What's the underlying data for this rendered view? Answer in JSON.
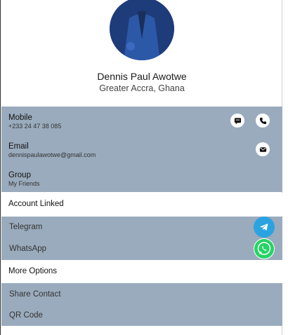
{
  "profile": {
    "name": "Dennis Paul Awotwe",
    "location": "Greater Accra, Ghana",
    "avatar_icon": "profile-photo"
  },
  "contact": {
    "mobile_label": "Mobile",
    "mobile_value": "+233 24 47 38 085",
    "email_label": "Email",
    "email_value": "dennispaulawotwe@gmail.com",
    "group_label": "Group",
    "group_value": "My Friends"
  },
  "accounts": {
    "header": "Account Linked",
    "telegram": "Telegram",
    "whatsapp": "WhatsApp"
  },
  "options": {
    "header": "More Options",
    "share": "Share Contact",
    "qr": "QR Code"
  },
  "colors": {
    "panel": "#9aabbd",
    "telegram": "#2aa3e0",
    "whatsapp": "#25d366"
  }
}
